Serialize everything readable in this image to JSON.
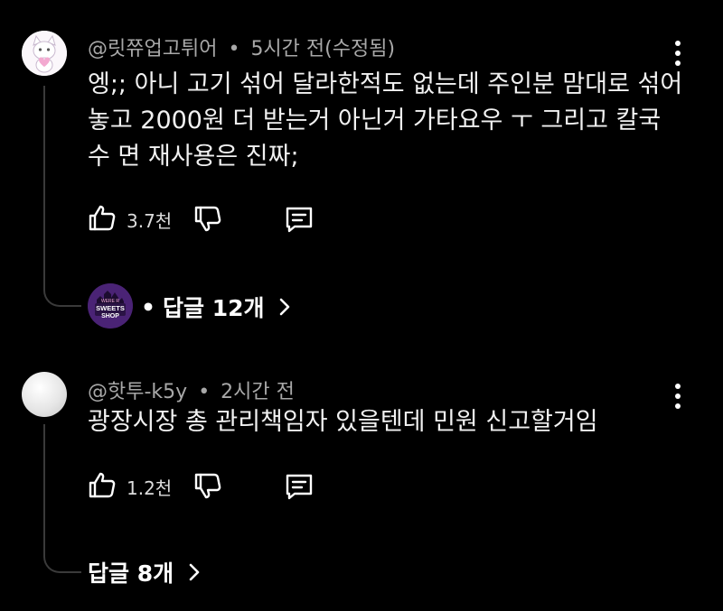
{
  "comments": [
    {
      "author": "@릿쮸업고튀어",
      "separator": "•",
      "time": "5시간 전(수정됨)",
      "lines": [
        "엥;; 아니 고기 섞어 달라한적도 없는데 주인분 맘대로 섞어",
        "놓고 2000원 더 받는거 아닌거 가타요우 ㅜ 그리고 칼국",
        "수 면 재사용은 진짜;"
      ],
      "likes": "3.7천",
      "replies_prefix": "•",
      "replies_label": "답글 12개",
      "reply_avatar_text": [
        "WERE R",
        "SWEETS",
        "SHOP"
      ]
    },
    {
      "author": "@핫투-k5y",
      "separator": "•",
      "time": "2시간 전",
      "lines": [
        "광장시장 총 관리책임자 있을텐데 민원 신고할거임"
      ],
      "likes": "1.2천",
      "replies_label": "답글 8개"
    }
  ],
  "icons": {
    "like": "thumbs-up-icon",
    "dislike": "thumbs-down-icon",
    "reply": "reply-icon",
    "more": "more-vertical-icon",
    "chevron": "chevron-right-icon"
  },
  "colors": {
    "background": "#000000",
    "meta_text": "#a8a8a8",
    "thread_line": "#3a3a3a",
    "reply_avatar": "#5a2a8a"
  }
}
